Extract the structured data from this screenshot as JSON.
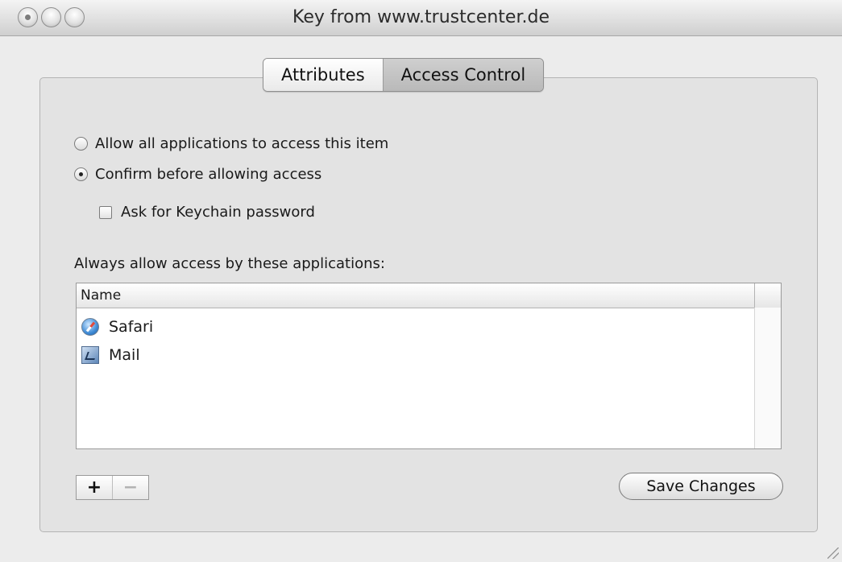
{
  "window": {
    "title": "Key from www.trustcenter.de"
  },
  "tabs": [
    {
      "label": "Attributes",
      "active": false
    },
    {
      "label": "Access Control",
      "active": true
    }
  ],
  "access": {
    "allow_all_label": "Allow all applications to access this item",
    "allow_all_selected": false,
    "confirm_label": "Confirm before allowing access",
    "confirm_selected": true,
    "ask_password_label": "Ask for Keychain password",
    "ask_password_checked": false
  },
  "apps_list": {
    "label": "Always allow access by these applications:",
    "column_header": "Name",
    "rows": [
      {
        "name": "Safari",
        "icon": "safari-icon"
      },
      {
        "name": "Mail",
        "icon": "mail-icon"
      }
    ]
  },
  "buttons": {
    "add_label": "+",
    "remove_label": "−",
    "save_label": "Save Changes"
  },
  "icons": {
    "close": "close-icon",
    "minimize": "minimize-icon",
    "zoom": "zoom-icon",
    "resize": "resize-grip-icon"
  }
}
